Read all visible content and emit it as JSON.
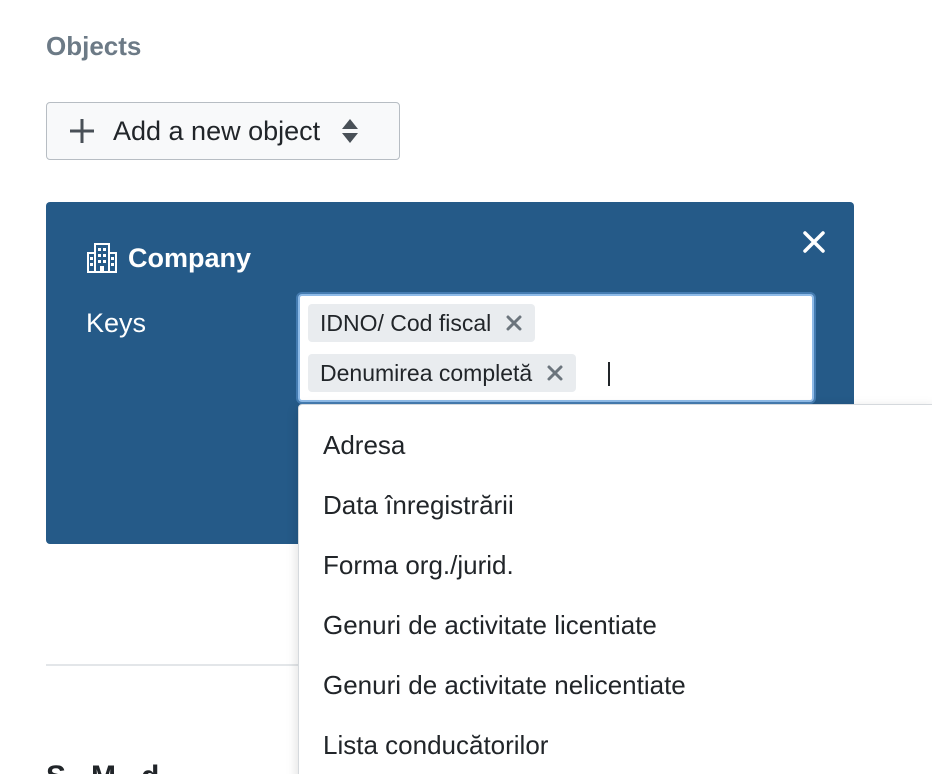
{
  "objects_section": {
    "heading": "Objects",
    "add_button_label": "Add a new object"
  },
  "object_card": {
    "title": "Company",
    "keys_label": "Keys",
    "selected_keys": [
      {
        "label": "IDNO/ Cod fiscal"
      },
      {
        "label": "Denumirea completă"
      }
    ],
    "accent_color": "#255a88"
  },
  "dropdown": {
    "options": [
      {
        "label": "Adresa"
      },
      {
        "label": "Data înregistrării"
      },
      {
        "label": "Forma org./jurid."
      },
      {
        "label": "Genuri de activitate licentiate"
      },
      {
        "label": "Genuri de activitate nelicentiate"
      },
      {
        "label": "Lista conducătorilor"
      }
    ]
  },
  "next_section": {
    "heading_partial": "S...M...d..."
  },
  "icons": {
    "add": "plus-icon",
    "sort": "sort-icon",
    "object": "building-icon",
    "close": "close-icon",
    "chip_remove": "times-icon"
  }
}
